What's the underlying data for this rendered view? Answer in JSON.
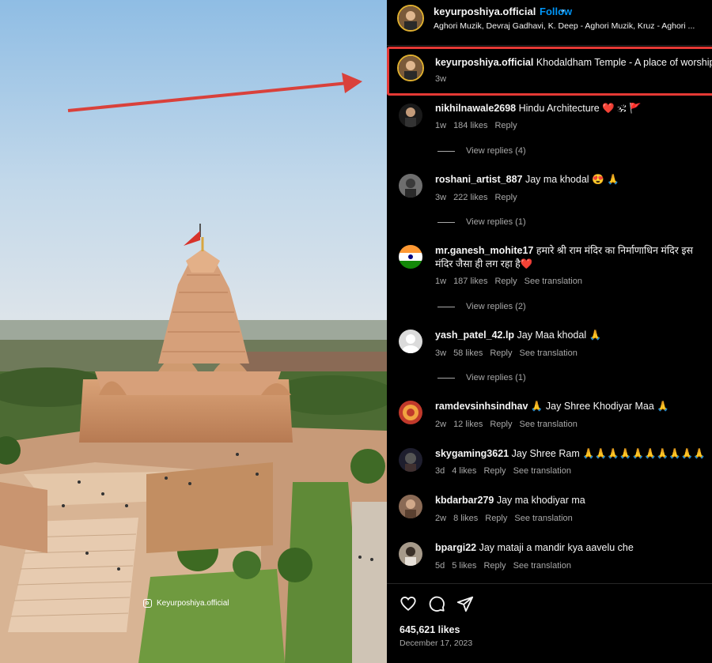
{
  "header": {
    "username": "keyurposhiya.official",
    "dot": "•",
    "follow": "Follow",
    "audio": "Aghori Muzik, Devraj Gadhavi, K. Deep - Aghori Muzik, Kruz - Aghori ..."
  },
  "caption": {
    "username": "keyurposhiya.official",
    "text": "Khodaldham Temple - A place of worship",
    "time": "3w"
  },
  "watermark": "Keyurposhiya.official",
  "comments": [
    {
      "username": "nikhilnawale2698",
      "text": "Hindu Architecture ❤️ 🕉 🚩",
      "time": "1w",
      "likes": "184 likes",
      "reply": "Reply",
      "translation": "",
      "view_replies": "View replies (4)"
    },
    {
      "username": "roshani_artist_887",
      "text": "Jay ma khodal 😍 🙏",
      "time": "3w",
      "likes": "222 likes",
      "reply": "Reply",
      "translation": "",
      "view_replies": "View replies (1)"
    },
    {
      "username": "mr.ganesh_mohite17",
      "text": "हमारे श्री राम मंदिर का निर्माणाधिन मंदिर इस",
      "text2": "मंदिर जैसा ही लग रहा है❤️",
      "time": "1w",
      "likes": "187 likes",
      "reply": "Reply",
      "translation": "See translation",
      "view_replies": "View replies (2)"
    },
    {
      "username": "yash_patel_42.lp",
      "text": "Jay Maa khodal 🙏",
      "time": "3w",
      "likes": "58 likes",
      "reply": "Reply",
      "translation": "See translation",
      "view_replies": "View replies (1)"
    },
    {
      "username": "ramdevsinhsindhav",
      "text": "🙏 Jay Shree Khodiyar Maa 🙏",
      "time": "2w",
      "likes": "12 likes",
      "reply": "Reply",
      "translation": "See translation",
      "view_replies": ""
    },
    {
      "username": "skygaming3621",
      "text": "Jay Shree Ram 🙏🙏🙏🙏🙏🙏🙏🙏🙏🙏",
      "time": "3d",
      "likes": "4 likes",
      "reply": "Reply",
      "translation": "See translation",
      "view_replies": ""
    },
    {
      "username": "kbdarbar279",
      "text": "Jay ma khodiyar ma",
      "time": "2w",
      "likes": "8 likes",
      "reply": "Reply",
      "translation": "See translation",
      "view_replies": ""
    },
    {
      "username": "bpargi22",
      "text": "Jay mataji a mandir kya aavelu che",
      "time": "5d",
      "likes": "5 likes",
      "reply": "Reply",
      "translation": "See translation",
      "view_replies": ""
    }
  ],
  "footer": {
    "likes": "645,621 likes",
    "date": "December 17, 2023"
  },
  "colors": {
    "accent": "#0095f6",
    "highlight_box": "#e53935",
    "arrow": "#d9413b"
  }
}
